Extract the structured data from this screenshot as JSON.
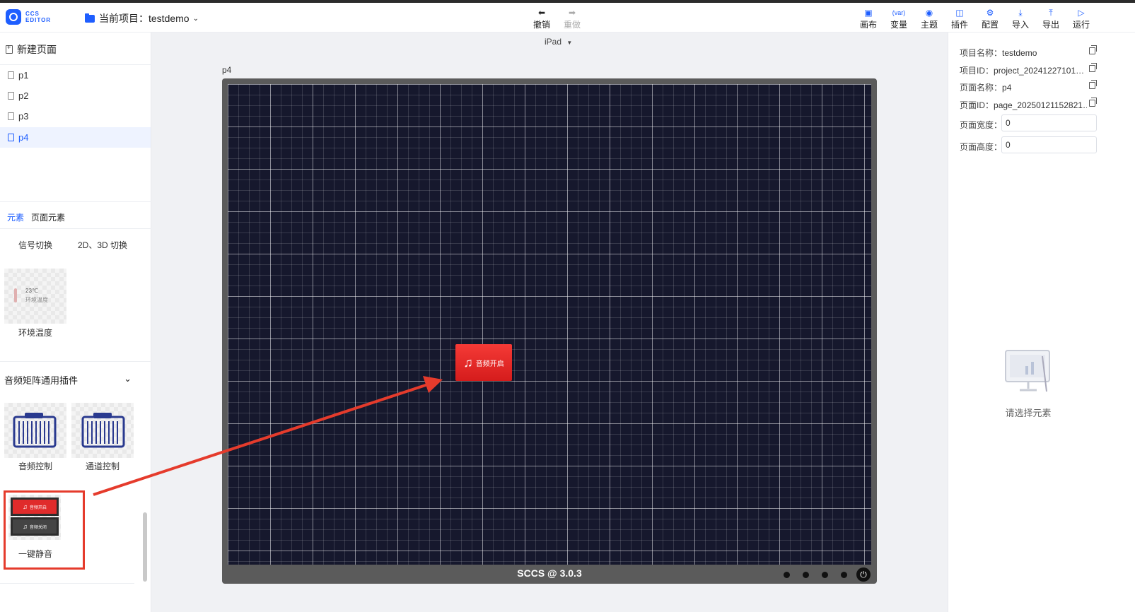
{
  "app": {
    "logo_line1": "CCS",
    "logo_line2": "EDITOR"
  },
  "header": {
    "project_label": "当前项目：",
    "project_name": "testdemo",
    "undo": "撤销",
    "redo": "重做",
    "tools": [
      "画布",
      "变量",
      "主题",
      "插件",
      "配置",
      "导入",
      "导出",
      "运行"
    ]
  },
  "left": {
    "new_page": "新建页面",
    "pages": [
      "p1",
      "p2",
      "p3",
      "p4"
    ],
    "active_page": "p4",
    "tabs": [
      "元素",
      "页面元素"
    ],
    "elements_top": [
      "信号切换",
      "2D、3D 切换"
    ],
    "env_temp": {
      "label": "环境温度",
      "value": "23℃",
      "sub": "环境温度"
    },
    "group_title": "音频矩阵通用插件",
    "plugins": [
      "音频控制",
      "通道控制",
      "一键静音"
    ],
    "mute_thumb": {
      "on_text": "音频开启",
      "off_text": "音频关闭"
    }
  },
  "canvas": {
    "device": "iPad",
    "page_label": "p4",
    "footer": "SCCS @ 3.0.3",
    "button_text": "音频开启"
  },
  "right": {
    "project_name_label": "项目名称：",
    "project_name": "testdemo",
    "project_id_label": "项目ID：",
    "project_id": "project_20241227101…",
    "page_name_label": "页面名称：",
    "page_name": "p4",
    "page_id_label": "页面ID：",
    "page_id": "page_20250121152821…",
    "width_label": "页面宽度：",
    "width_value": "0",
    "height_label": "页面高度：",
    "height_value": "0",
    "empty_text": "请选择元素"
  },
  "colors": {
    "accent": "#1e5eff",
    "annotation": "#e53b2c",
    "canvas_bg": "#16182d"
  }
}
